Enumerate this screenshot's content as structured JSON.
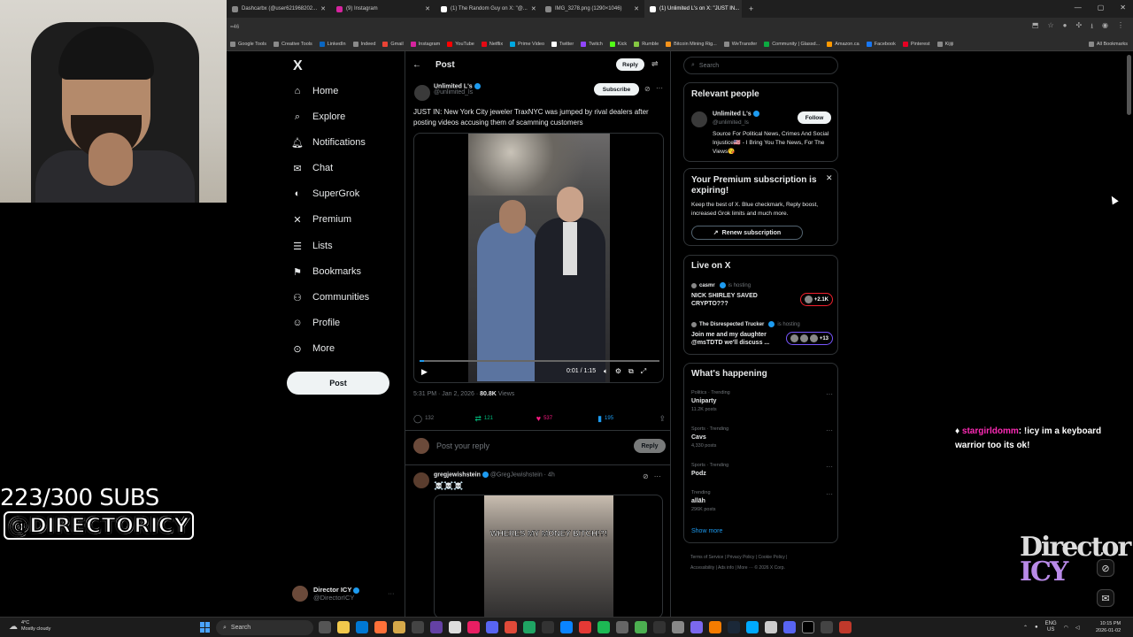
{
  "browser": {
    "tabs": [
      {
        "title": "Dashcarbx (@user621968202...",
        "active": false
      },
      {
        "title": "(9) Instagram",
        "active": false
      },
      {
        "title": "(1) The Random Guy on X: \"@...",
        "active": false
      },
      {
        "title": "IMG_3278.png (1290×1046)",
        "active": false
      },
      {
        "title": "(1) Unlimited L's on X: \"JUST IN...",
        "active": true
      }
    ],
    "new_tab": "+",
    "address": "=46",
    "bookmarks": [
      "Google Tools",
      "Creative Tools",
      "LinkedIn",
      "Indeed",
      "Gmail",
      "Instagram",
      "YouTube",
      "Netflix",
      "Prime Video",
      "Twitter",
      "Twitch",
      "Kick",
      "Rumble",
      "Bitcoin Mining Rig...",
      "WeTransfer",
      "Community | Glassd...",
      "Amazon.ca",
      "Facebook",
      "Pinterest",
      "Kijiji"
    ],
    "all_bookmarks": "All Bookmarks"
  },
  "overlay": {
    "subs": "223/300 SUBS",
    "handle": "@DIRECTORICY",
    "chat_user": "stargirldomm",
    "chat_message": ": !icy im a keyboard warrior too its ok!",
    "watermark_line1": "Director",
    "watermark_line2": "ICY"
  },
  "sidebar": {
    "logo": "X",
    "items": [
      {
        "label": "Home",
        "icon": "home-icon"
      },
      {
        "label": "Explore",
        "icon": "search-icon"
      },
      {
        "label": "Notifications",
        "icon": "bell-icon"
      },
      {
        "label": "Chat",
        "icon": "mail-icon"
      },
      {
        "label": "SuperGrok",
        "icon": "grok-icon"
      },
      {
        "label": "Premium",
        "icon": "x-icon"
      },
      {
        "label": "Lists",
        "icon": "list-icon"
      },
      {
        "label": "Bookmarks",
        "icon": "bookmark-icon"
      },
      {
        "label": "Communities",
        "icon": "people-icon"
      },
      {
        "label": "Profile",
        "icon": "person-icon"
      },
      {
        "label": "More",
        "icon": "more-circle-icon"
      }
    ],
    "post_button": "Post",
    "account": {
      "name": "Director ICY",
      "handle": "@DirectorICY"
    }
  },
  "main": {
    "header_title": "Post",
    "reply_label": "Reply",
    "tweet": {
      "author_name": "Unlimited L's",
      "author_handle": "@unlimited_ls",
      "subscribe": "Subscribe",
      "text": "JUST IN: New York City jeweler TraxNYC was jumped by rival dealers after posting videos accusing them of scamming customers",
      "video_time": "0:01 / 1:15",
      "video_progress": 0.02,
      "timestamp": "5:31 PM · Jan 2, 2026 · ",
      "views_count": "80.8K",
      "views_label": " Views",
      "replies": "132",
      "reposts": "121",
      "likes": "537",
      "bookmarks": "195"
    },
    "reply_placeholder": "Post your reply",
    "reply_button": "Reply",
    "reply2": {
      "name": "gregjewishstein",
      "handle": "@GregJewishstein · 4h",
      "text": "☠️☠️☠️",
      "caption": "WHERES MY MONEY BITCH!?!"
    }
  },
  "right": {
    "search_placeholder": "Search",
    "relevant_title": "Relevant people",
    "relevant": {
      "name": "Unlimited L's",
      "handle": "@unlimited_ls",
      "follow": "Follow",
      "bio": "Source For Political News, Crimes And Social Injustice🇺🇸 - I Bring You The News, For The Views😘"
    },
    "premium": {
      "title": "Your Premium subscription is expiring!",
      "body": "Keep the best of X. Blue checkmark, Reply boost, increased Grok limits and much more.",
      "button": "Renew subscription"
    },
    "live_title": "Live on X",
    "live": [
      {
        "host": "casmr",
        "label": "is hosting",
        "title": "NICK SHIRLEY SAVED CRYPTO???",
        "count": "+2.1K",
        "color": "#f4212e"
      },
      {
        "host": "The Disrespected Trucker",
        "label": "is hosting",
        "title": "Join me and my daughter @msTDTD we'll discuss ...",
        "count": "+13",
        "color": "#7856ff"
      }
    ],
    "trends_title": "What's happening",
    "trends": [
      {
        "context": "Politics · Trending",
        "name": "Uniparty",
        "count": "11.2K posts"
      },
      {
        "context": "Sports · Trending",
        "name": "Cavs",
        "count": "4,330 posts"
      },
      {
        "context": "Sports · Trending",
        "name": "Podz",
        "count": ""
      },
      {
        "context": "Trending",
        "name": "allāh",
        "count": "296K posts"
      }
    ],
    "show_more": "Show more",
    "footer_line1": "Terms of Service | Privacy Policy | Cookie Policy |",
    "footer_line2": "Accessibility | Ads info | More ··· © 2026 X Corp."
  },
  "taskbar": {
    "weather_temp": "4°C",
    "weather_text": "Mostly cloudy",
    "search": "Search",
    "lang1": "ENG",
    "lang2": "US",
    "time": "10:15 PM",
    "date": "2026-01-02"
  },
  "colors": {
    "accent": "#1d9bf0",
    "like": "#f91880",
    "repost": "#00ba7c",
    "chat_user": "#ff2bb6"
  }
}
